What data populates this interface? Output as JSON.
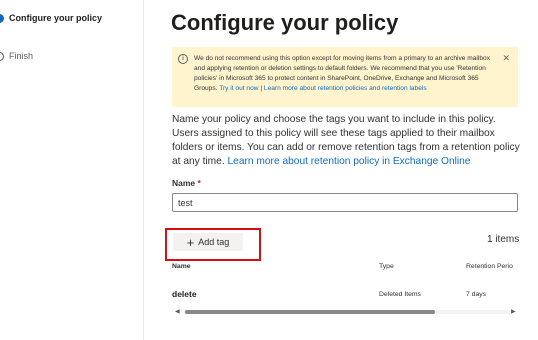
{
  "steps": [
    {
      "label": "Configure your policy",
      "state": "current"
    },
    {
      "label": "Finish",
      "state": "pending"
    }
  ],
  "page": {
    "title": "Configure your policy"
  },
  "warning": {
    "icon": "info-icon",
    "text": "We do not recommend using this option except for moving items from a primary to an archive mailbox and applying retention or deletion settings to default folders. We recommend that you use 'Retention policies' in Microsoft 365 to protect content in SharePoint, OneDrive, Exchange and Microsoft 365 Groups.",
    "link1": "Try it out now",
    "separator": " | ",
    "link2": "Learn more about retention policies and retention labels"
  },
  "description": {
    "text": "Name your policy and choose the tags you want to include in this policy. Users assigned to this policy will see these tags applied to their mailbox folders or items. You can add or remove retention tags from a retention policy at any time.",
    "link": "Learn more about retention policy in Exchange Online"
  },
  "form": {
    "name_label": "Name",
    "required_mark": "*",
    "name_value": "test"
  },
  "toolbar": {
    "add_tag_label": "Add tag",
    "items_count": "1 items"
  },
  "table": {
    "columns": [
      "Name",
      "Type",
      "Retention Perio"
    ],
    "rows": [
      {
        "name": "delete",
        "type": "Deleted Items",
        "retention": "7 days"
      }
    ]
  },
  "colors": {
    "accent": "#0f6cbd",
    "warning_bg": "#fff4ce",
    "highlight": "#d80f0f"
  }
}
